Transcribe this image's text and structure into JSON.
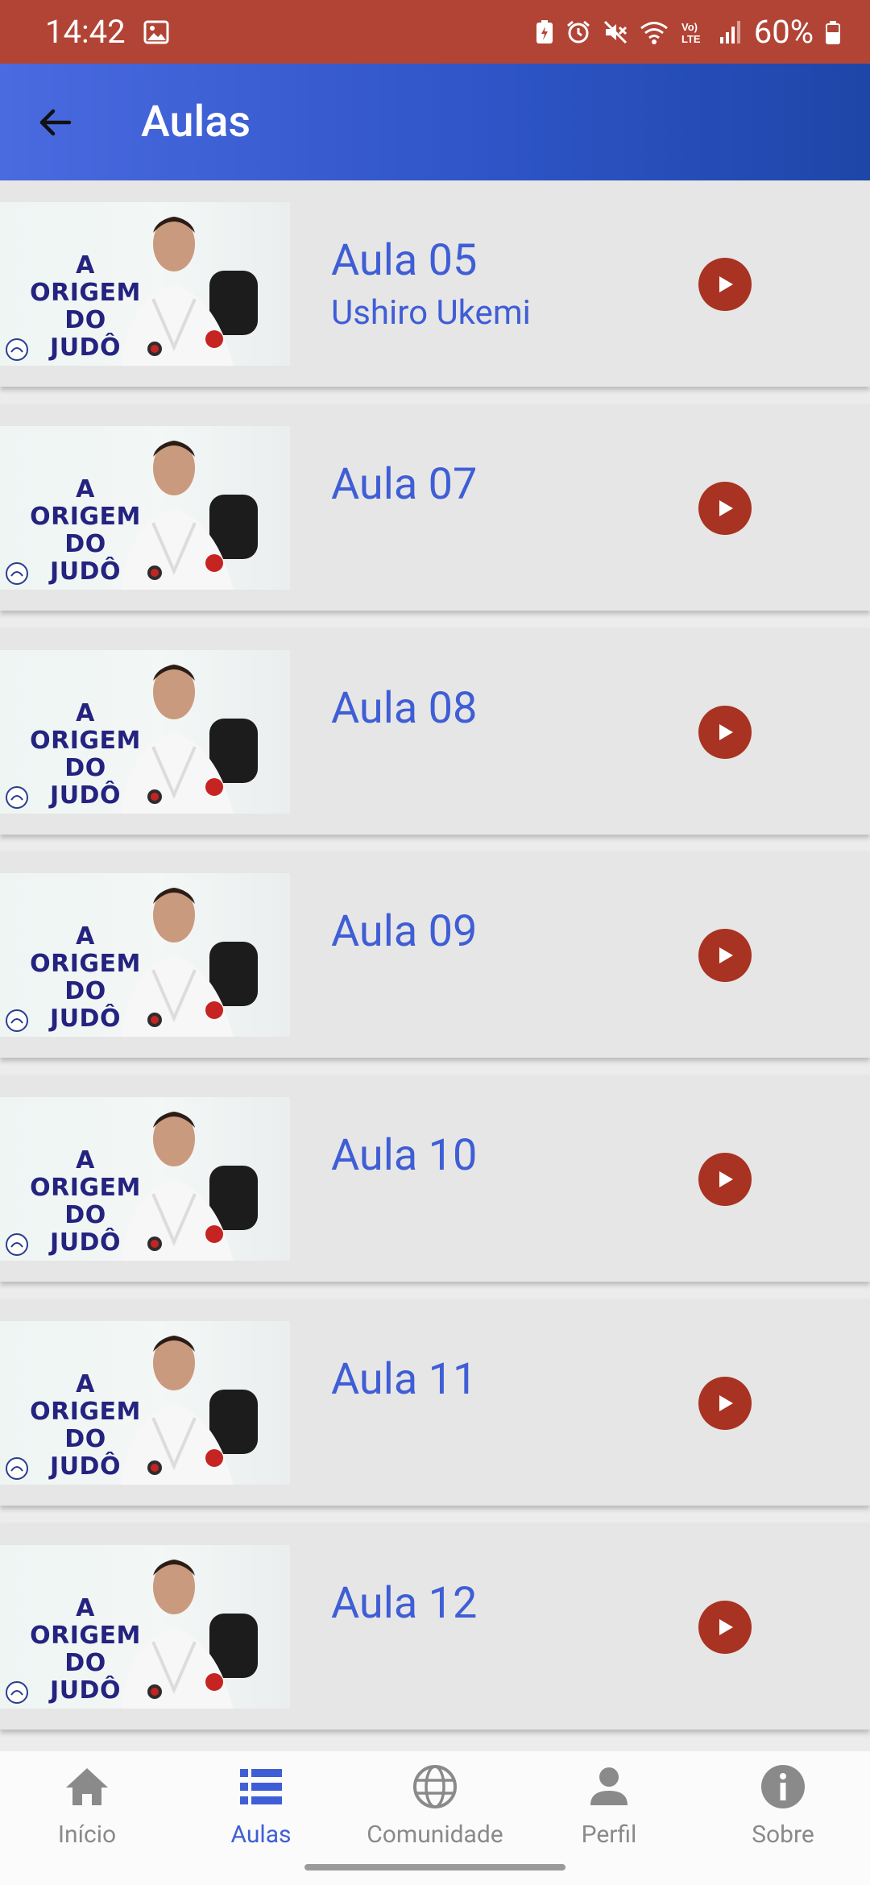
{
  "status": {
    "time": "14:42",
    "battery": "60%"
  },
  "appbar": {
    "title": "Aulas"
  },
  "thumbnail": {
    "line1": "A ORIGEM",
    "line2": "DO JUDÔ"
  },
  "lessons": [
    {
      "title": "Aula 05",
      "subtitle": "Ushiro Ukemi"
    },
    {
      "title": "Aula 07",
      "subtitle": ""
    },
    {
      "title": "Aula 08",
      "subtitle": ""
    },
    {
      "title": "Aula 09",
      "subtitle": ""
    },
    {
      "title": "Aula 10",
      "subtitle": ""
    },
    {
      "title": "Aula 11",
      "subtitle": ""
    },
    {
      "title": "Aula 12",
      "subtitle": ""
    }
  ],
  "nav": [
    {
      "label": "Início",
      "icon": "home-icon",
      "active": false
    },
    {
      "label": "Aulas",
      "icon": "list-icon",
      "active": true
    },
    {
      "label": "Comunidade",
      "icon": "globe-icon",
      "active": false
    },
    {
      "label": "Perfil",
      "icon": "person-icon",
      "active": false
    },
    {
      "label": "Sobre",
      "icon": "info-icon",
      "active": false
    }
  ],
  "colors": {
    "status_bar": "#b24436",
    "app_bar_start": "#4a6ae0",
    "app_bar_end": "#1e46a8",
    "accent": "#3f5ed6",
    "play_button": "#a83322",
    "card_bg": "#e6e6e6"
  }
}
